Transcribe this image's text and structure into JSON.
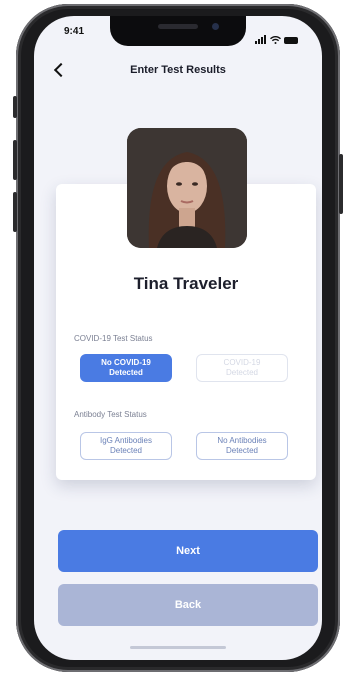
{
  "status_bar": {
    "time": "9:41"
  },
  "nav": {
    "title": "Enter Test Results"
  },
  "profile": {
    "name": "Tina Traveler"
  },
  "covid": {
    "label": "COVID-19 Test Status",
    "options": [
      "No COVID-19\nDetected",
      "COVID-19\nDetected"
    ]
  },
  "antibody": {
    "label": "Antibody Test Status",
    "options": [
      "IgG Antibodies\nDetected",
      "No Antibodies\nDetected"
    ]
  },
  "buttons": {
    "next": "Next",
    "back": "Back"
  },
  "colors": {
    "accent": "#4a7be3",
    "back_button": "#aab5d6",
    "screen_bg": "#f2f3f9"
  }
}
